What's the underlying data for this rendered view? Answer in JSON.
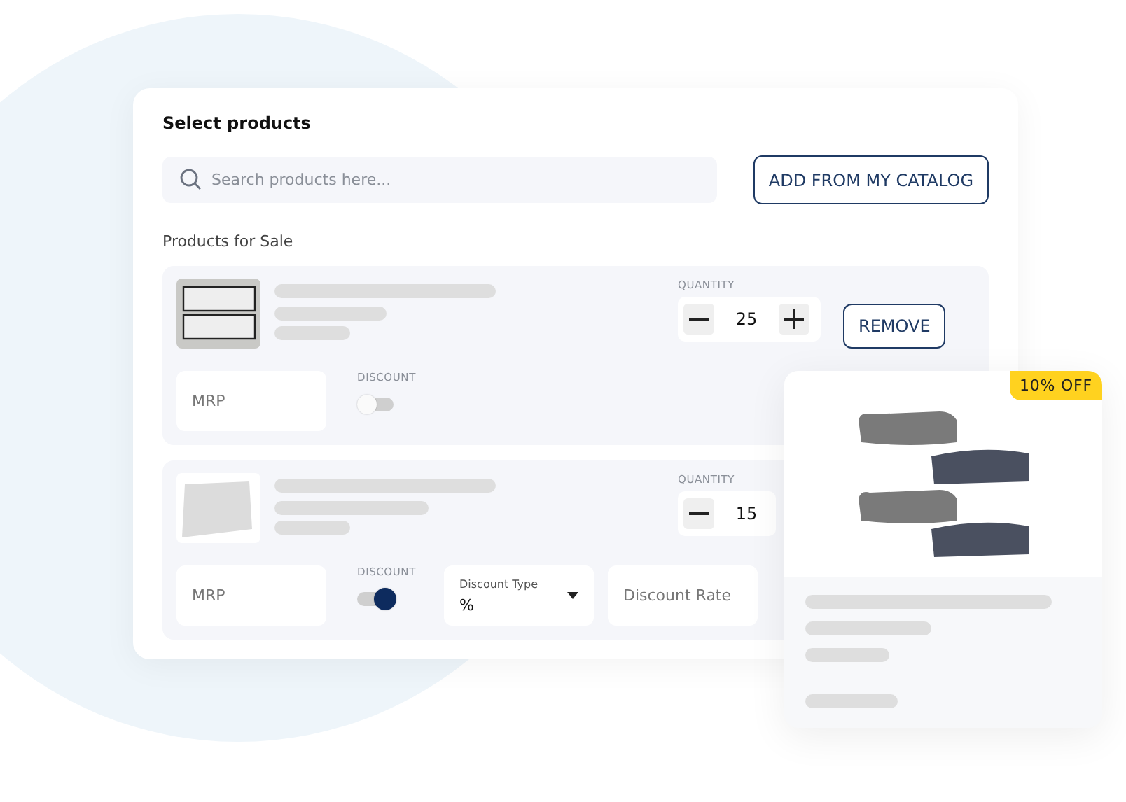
{
  "panel": {
    "title": "Select products",
    "search": {
      "placeholder": "Search products here..."
    },
    "catalog_button": "ADD FROM MY CATALOG",
    "section_label": "Products for Sale"
  },
  "products": [
    {
      "quantity_label": "QUANTITY",
      "quantity": "25",
      "show_plus": true,
      "remove_button": "REMOVE",
      "mrp_placeholder": "MRP",
      "discount_label": "DISCOUNT",
      "discount_on": false
    },
    {
      "quantity_label": "QUANTITY",
      "quantity": "15",
      "show_plus": false,
      "mrp_placeholder": "MRP",
      "discount_label": "DISCOUNT",
      "discount_on": true,
      "discount_type": {
        "label": "Discount Type",
        "value": "%"
      },
      "discount_rate_placeholder": "Discount Rate"
    }
  ],
  "preview_card": {
    "badge": "10% OFF"
  }
}
